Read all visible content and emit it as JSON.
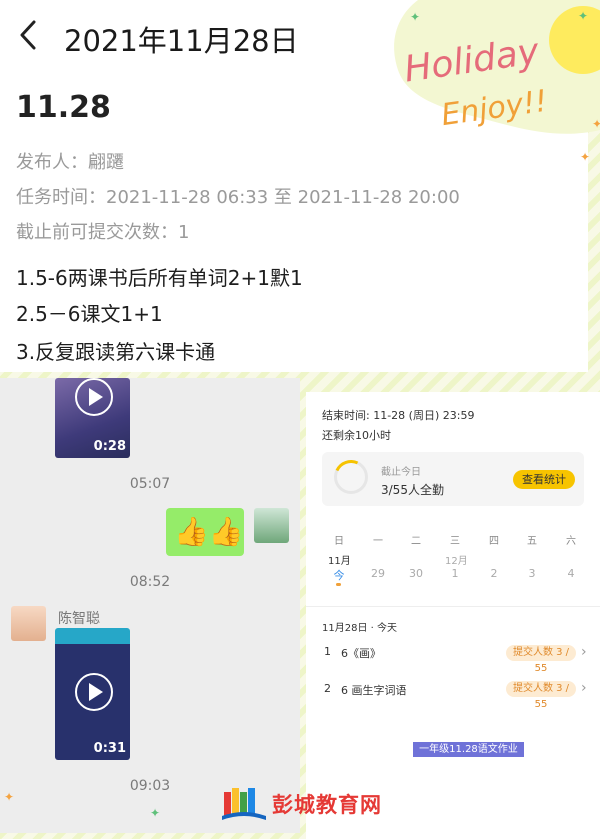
{
  "nav": {
    "title": "2021年11月28日"
  },
  "decor": {
    "holiday_line1": "Holiday",
    "holiday_line2": "Enjoy!!"
  },
  "task": {
    "title": "11.28",
    "publisher": "发布人：翩躚",
    "time_range": "任务时间：2021-11-28 06:33 至 2021-11-28 20:00",
    "submit_limit": "截止前可提交次数：1",
    "items": [
      "1.5-6两课书后所有单词2+1默1",
      "2.5－6课文1+1",
      "3.反复跟读第六课卡通"
    ]
  },
  "chat": {
    "video1_duration": "0:28",
    "time1": "05:07",
    "bubble_emoji": "👍👍",
    "time2": "08:52",
    "sender_name": "陈智聪",
    "video2_duration": "0:31",
    "time3": "09:03"
  },
  "panel": {
    "end_time": "结束时间: 11-28 (周日) 23:59",
    "remaining": "还剩余10小时",
    "deadline_label": "截止今日",
    "progress_text": "3/55人全勤",
    "stats_button": "查看统计",
    "weekdays": [
      "日",
      "一",
      "二",
      "三",
      "四",
      "五",
      "六"
    ],
    "month_left": "11月",
    "month_right": "12月",
    "days": [
      "今",
      "29",
      "30",
      "1",
      "2",
      "3",
      "4"
    ],
    "date_header": "11月28日 · 今天",
    "assignments": [
      {
        "num": "1",
        "name": "6《画》",
        "badge": "提交人数 3 / 55"
      },
      {
        "num": "2",
        "name": "6 画生字词语",
        "badge": "提交人数 3 / 55"
      }
    ],
    "tag": "一年级11.28语文作业"
  },
  "footer": {
    "logo_text": "彭城教育网"
  },
  "colors": {
    "accent_yellow": "#f7c400",
    "chat_green": "#95ec69",
    "tag_purple": "#6f72d8",
    "logo_red": "#e53935"
  }
}
